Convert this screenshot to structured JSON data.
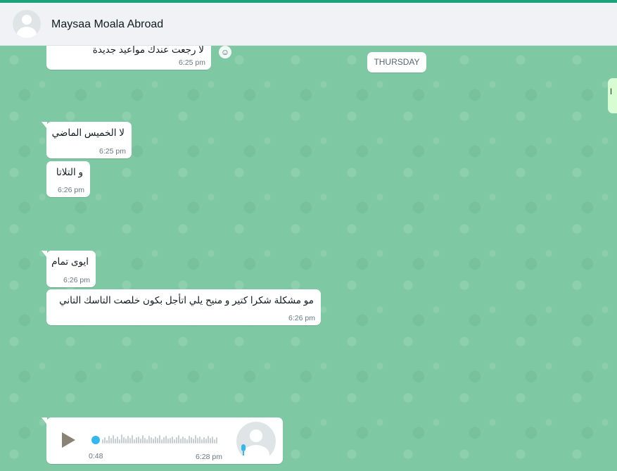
{
  "header": {
    "contact_name": "Maysaa Moala Abroad",
    "avatar_icon": "default-avatar-icon"
  },
  "day_separator": "THURSDAY",
  "messages": [
    {
      "text": "لا رجعت عندك مواعيد جديدة",
      "time": "6:25 pm"
    },
    {
      "text": "لا الخميس الماضي",
      "time": "6:25 pm"
    },
    {
      "text": "و التلاتا",
      "time": "6:26 pm"
    },
    {
      "text": "ايوى تمام",
      "time": "6:26 pm"
    },
    {
      "text": "مو مشكلة شكرا كتير و منيح يلي اتأجل بكون خلصت التاسك التاني",
      "time": "6:26 pm"
    }
  ],
  "voice_message": {
    "duration": "0:48",
    "time": "6:28 pm",
    "progress": 0
  },
  "peek_text": "ا",
  "colors": {
    "accent": "#1aa27d",
    "background": "#7ec9a3",
    "bubble": "#ffffff",
    "voice_dot": "#34b7f1"
  }
}
